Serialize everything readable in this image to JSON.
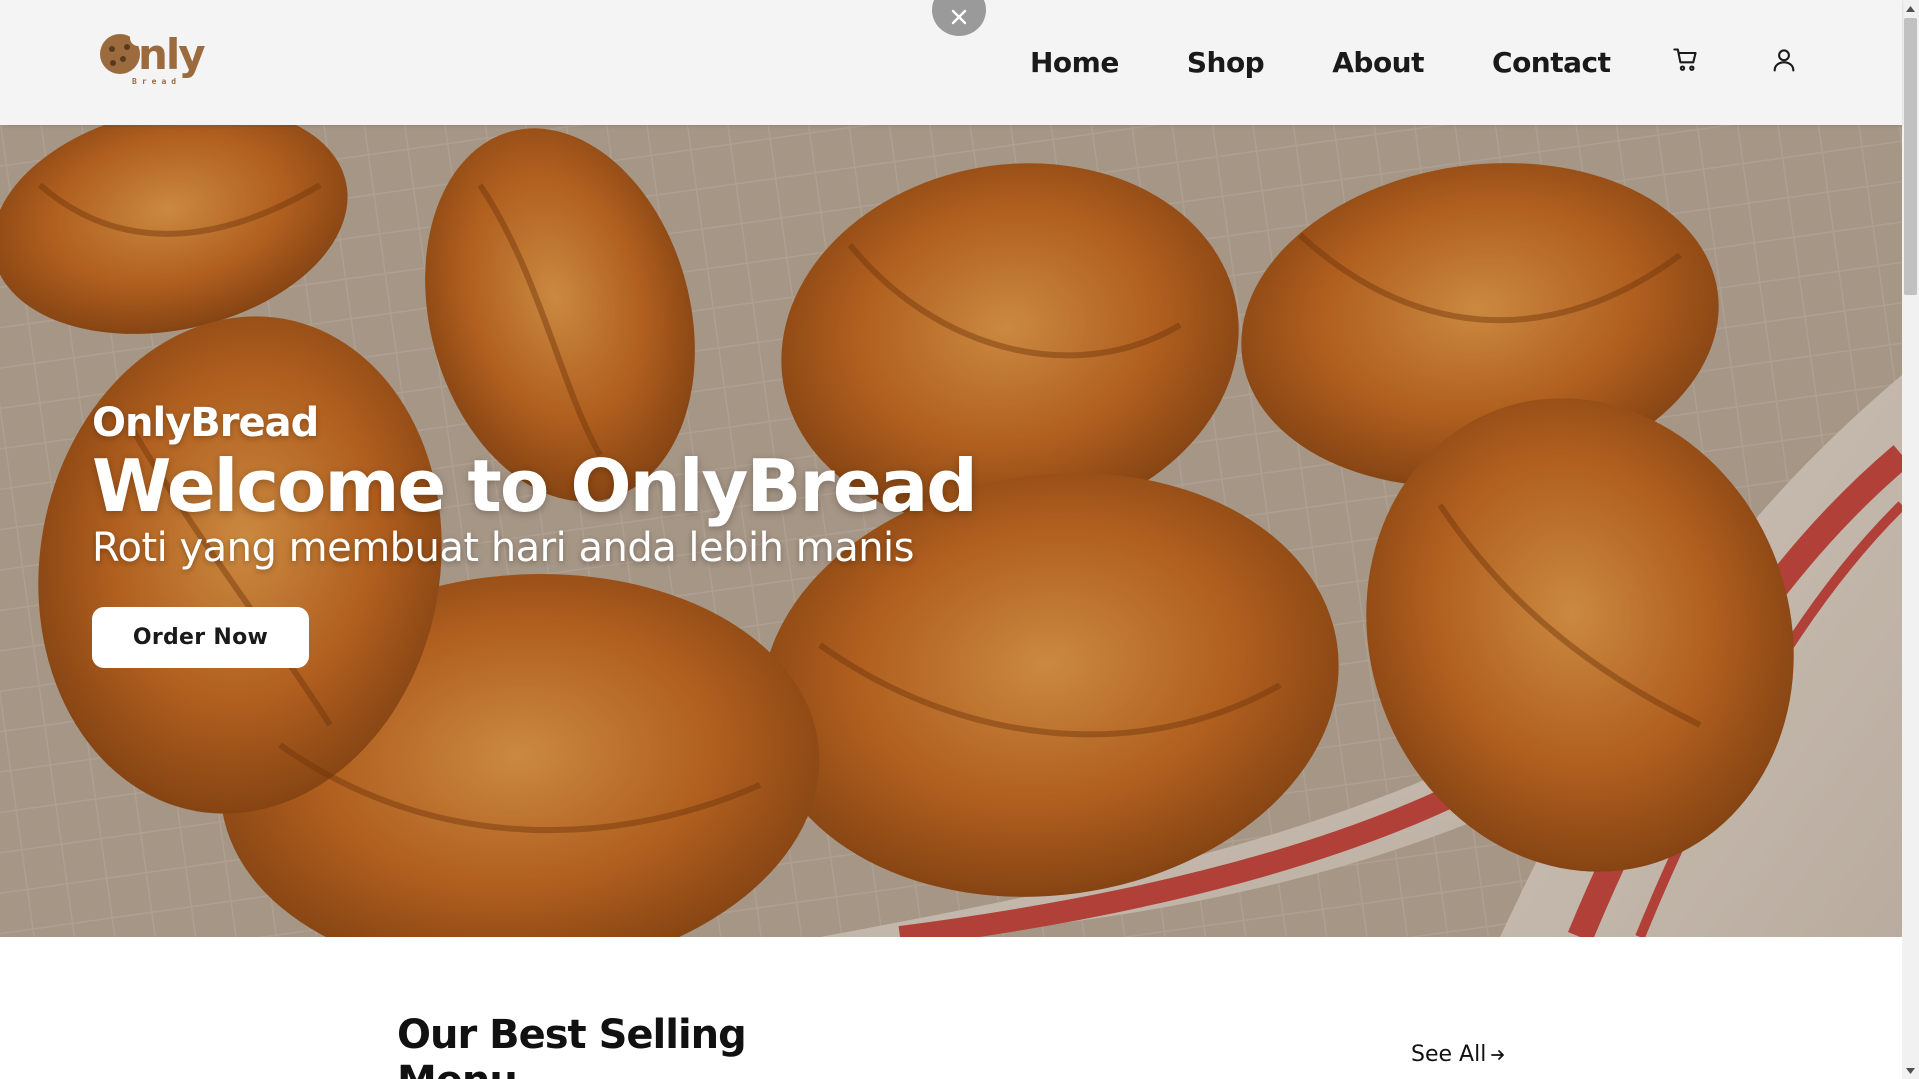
{
  "header": {
    "logo_text": "nly",
    "logo_subtext": "Bread",
    "nav": [
      {
        "label": "Home"
      },
      {
        "label": "Shop"
      },
      {
        "label": "About"
      },
      {
        "label": "Contact"
      }
    ],
    "cart_icon": "cart-icon",
    "user_icon": "user-icon",
    "close_icon": "close-icon"
  },
  "hero": {
    "brand": "OnlyBread",
    "title": "Welcome to OnlyBread",
    "subtitle": "Roti yang membuat hari anda lebih manis",
    "cta_label": "Order Now"
  },
  "best_selling": {
    "title": "Our Best Selling Menu",
    "see_all_label": "See All",
    "see_all_icon": "arrow-right-icon"
  },
  "colors": {
    "brand_brown": "#9b6a3d",
    "header_bg": "#f4f4f4",
    "text_dark": "#111111",
    "button_bg": "#ffffff"
  }
}
